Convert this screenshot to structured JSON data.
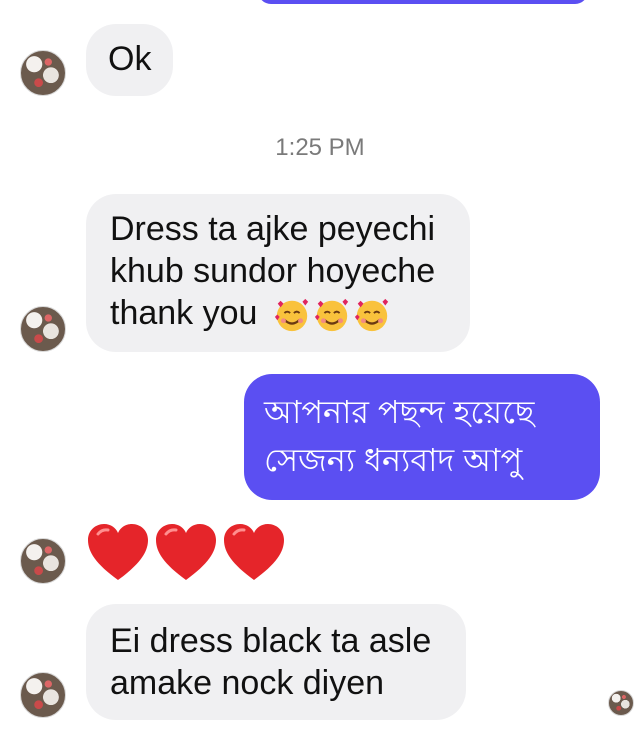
{
  "timestamp": "1:25 PM",
  "messages": {
    "ok": {
      "text": "Ok"
    },
    "dress_received": {
      "lines": [
        "Dress ta ajke peyechi",
        "khub sundor hoyeche",
        "thank you"
      ],
      "trailing_emoji": [
        "smiling-face-with-hearts",
        "smiling-face-with-hearts",
        "smiling-face-with-hearts"
      ]
    },
    "reply": {
      "lines": [
        "আপনার পছন্দ হয়েছে",
        "সেজন্য ধন্যবাদ আপু"
      ]
    },
    "hearts": {
      "emoji": [
        "red-heart",
        "red-heart",
        "red-heart"
      ]
    },
    "request": {
      "lines": [
        "Ei dress black ta asle",
        "amake nock diyen"
      ]
    }
  },
  "colors": {
    "outgoing_bubble": "#5b4ff2",
    "incoming_bubble": "#f0f0f2",
    "timestamp_text": "#7a7a7a"
  }
}
